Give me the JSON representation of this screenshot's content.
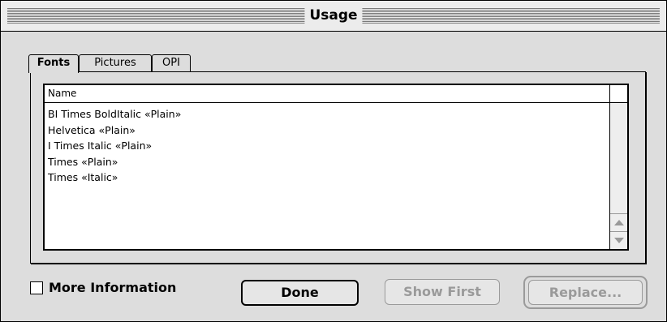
{
  "window": {
    "title": "Usage"
  },
  "tabs": [
    {
      "label": "Fonts",
      "active": true
    },
    {
      "label": "Pictures",
      "active": false
    },
    {
      "label": "OPI",
      "active": false
    }
  ],
  "list": {
    "column_header": "Name",
    "rows": [
      "BI Times BoldItalic «Plain»",
      "Helvetica «Plain»",
      "I Times Italic «Plain»",
      "Times «Plain»",
      "Times «Italic»"
    ]
  },
  "controls": {
    "more_information_label": "More Information",
    "more_information_checked": false,
    "done_label": "Done",
    "show_first_label": "Show First",
    "replace_label": "Replace..."
  },
  "icons": {
    "scroll_up": "up-arrow-icon",
    "scroll_down": "down-arrow-icon"
  }
}
